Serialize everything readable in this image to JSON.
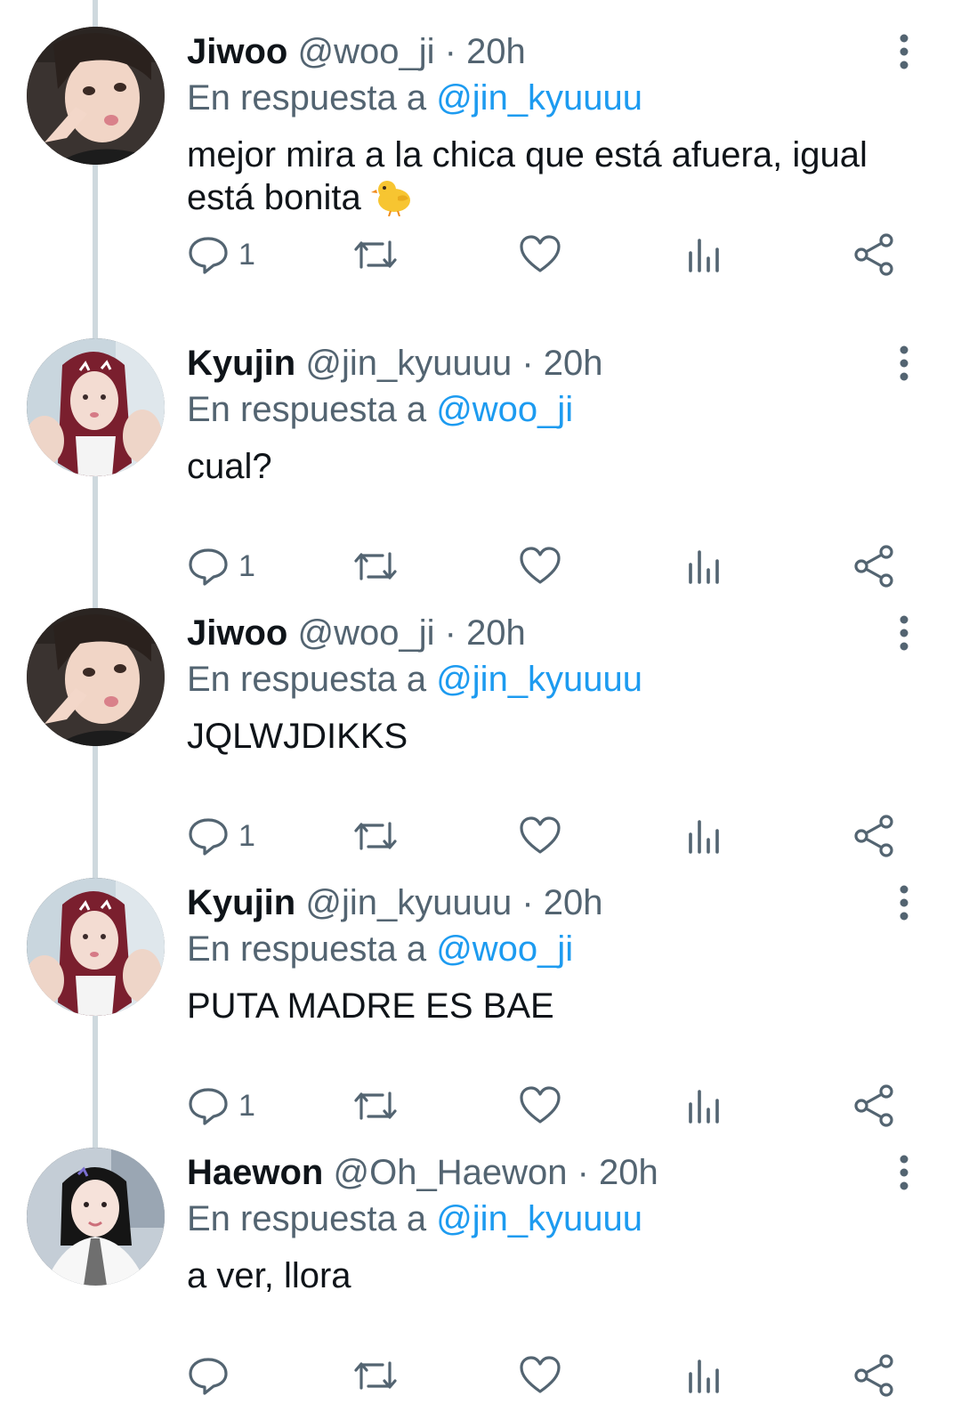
{
  "tweets": [
    {
      "name": "Jiwoo",
      "handle": "@woo_ji",
      "sep": "·",
      "time": "20h",
      "reply_prefix": "En respuesta a",
      "reply_to": "@jin_kyuuuu",
      "text": "mejor mira a la chica que está afuera, igual está bonita",
      "emoji": "chick-emoji",
      "reply_count": "1",
      "avatar": "jiwoo-avatar"
    },
    {
      "name": "Kyujin",
      "handle": "@jin_kyuuuu",
      "sep": "·",
      "time": "20h",
      "reply_prefix": "En respuesta a",
      "reply_to": "@woo_ji",
      "text": "cual?",
      "reply_count": "1",
      "avatar": "kyujin-avatar"
    },
    {
      "name": "Jiwoo",
      "handle": "@woo_ji",
      "sep": "·",
      "time": "20h",
      "reply_prefix": "En respuesta a",
      "reply_to": "@jin_kyuuuu",
      "text": "JQLWJDIKKS",
      "reply_count": "1",
      "avatar": "jiwoo-avatar"
    },
    {
      "name": "Kyujin",
      "handle": "@jin_kyuuuu",
      "sep": "·",
      "time": "20h",
      "reply_prefix": "En respuesta a",
      "reply_to": "@woo_ji",
      "text": "PUTA MADRE ES BAE",
      "reply_count": "1",
      "avatar": "kyujin-avatar"
    },
    {
      "name": "Haewon",
      "handle": "@Oh_Haewon",
      "sep": "·",
      "time": "20h",
      "reply_prefix": "En respuesta a",
      "reply_to": "@jin_kyuuuu",
      "text": "a ver, llora",
      "reply_count": "",
      "avatar": "haewon-avatar"
    }
  ],
  "icons": {
    "reply": "reply-icon",
    "retweet": "retweet-icon",
    "like": "heart-icon",
    "views": "views-icon",
    "share": "share-icon",
    "more": "more-options-icon"
  },
  "colors": {
    "text_primary": "#0f1419",
    "text_secondary": "#536471",
    "mention": "#1d9bf0",
    "thread_line": "#cfd9de"
  }
}
